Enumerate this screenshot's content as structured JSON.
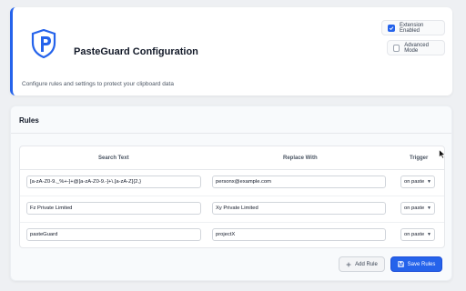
{
  "header": {
    "title": "PasteGuard Configuration",
    "subtitle": "Configure rules and settings to protect your clipboard data",
    "extension_enabled_label": "Extension Enabled",
    "extension_enabled": true,
    "advanced_mode_label": "Advanced Mode",
    "advanced_mode": false
  },
  "rules": {
    "title": "Rules",
    "columns": [
      "Search Text",
      "Replace With",
      "Trigger"
    ],
    "rows": [
      {
        "search": "[a-zA-Z0-9._%+-]+@[a-zA-Z0-9.-]+\\.[a-zA-Z]{2,}",
        "replace": "personx@example.com",
        "trigger": "on paste"
      },
      {
        "search": "Fz Private Limited",
        "replace": "Xy Private Limited",
        "trigger": "on paste"
      },
      {
        "search": "pasteGuard",
        "replace": "projectX",
        "trigger": "on paste"
      }
    ],
    "add_label": "Add Rule",
    "save_label": "Save Rules"
  },
  "colors": {
    "accent": "#2563eb",
    "background": "#eef0f3"
  },
  "icons": {
    "logo": "shield-p-logo",
    "add": "plus-icon",
    "save": "save-icon",
    "check": "check-icon",
    "dropdown": "chevron-down-icon"
  }
}
